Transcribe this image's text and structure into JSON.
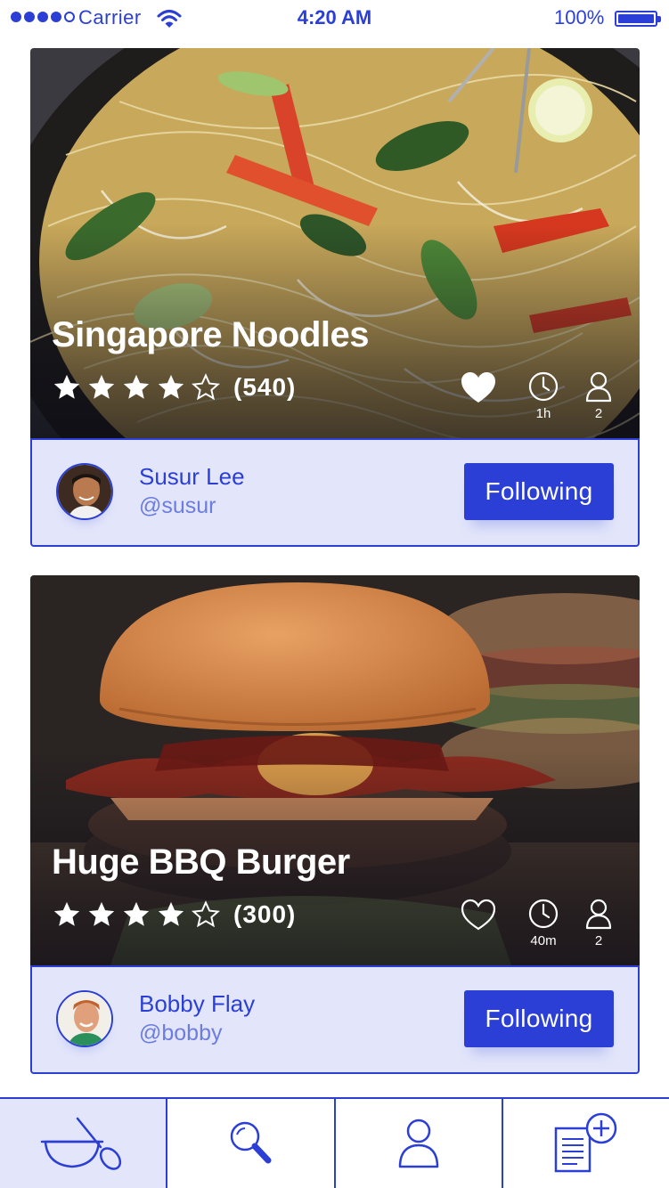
{
  "status_bar": {
    "carrier": "Carrier",
    "time": "4:20 AM",
    "battery": "100%"
  },
  "recipes": [
    {
      "title": "Singapore Noodles",
      "rating": 4,
      "rating_count": "(540)",
      "favorited": true,
      "time": "1h",
      "servings": "2",
      "author": {
        "name": "Susur Lee",
        "handle": "@susur"
      },
      "follow_label": "Following"
    },
    {
      "title": "Huge BBQ Burger",
      "rating": 4,
      "rating_count": "(300)",
      "favorited": false,
      "time": "40m",
      "servings": "2",
      "author": {
        "name": "Bobby Flay",
        "handle": "@bobby"
      },
      "follow_label": "Following"
    }
  ],
  "tab_bar": {
    "tabs": [
      {
        "icon": "bowl-spoon-icon",
        "active": true
      },
      {
        "icon": "search-icon",
        "active": false
      },
      {
        "icon": "profile-icon",
        "active": false
      },
      {
        "icon": "add-recipe-icon",
        "active": false
      }
    ]
  },
  "colors": {
    "accent": "#2b3fd6",
    "author_bar_bg": "#e3e6fa",
    "handle": "#6d7ce0"
  }
}
